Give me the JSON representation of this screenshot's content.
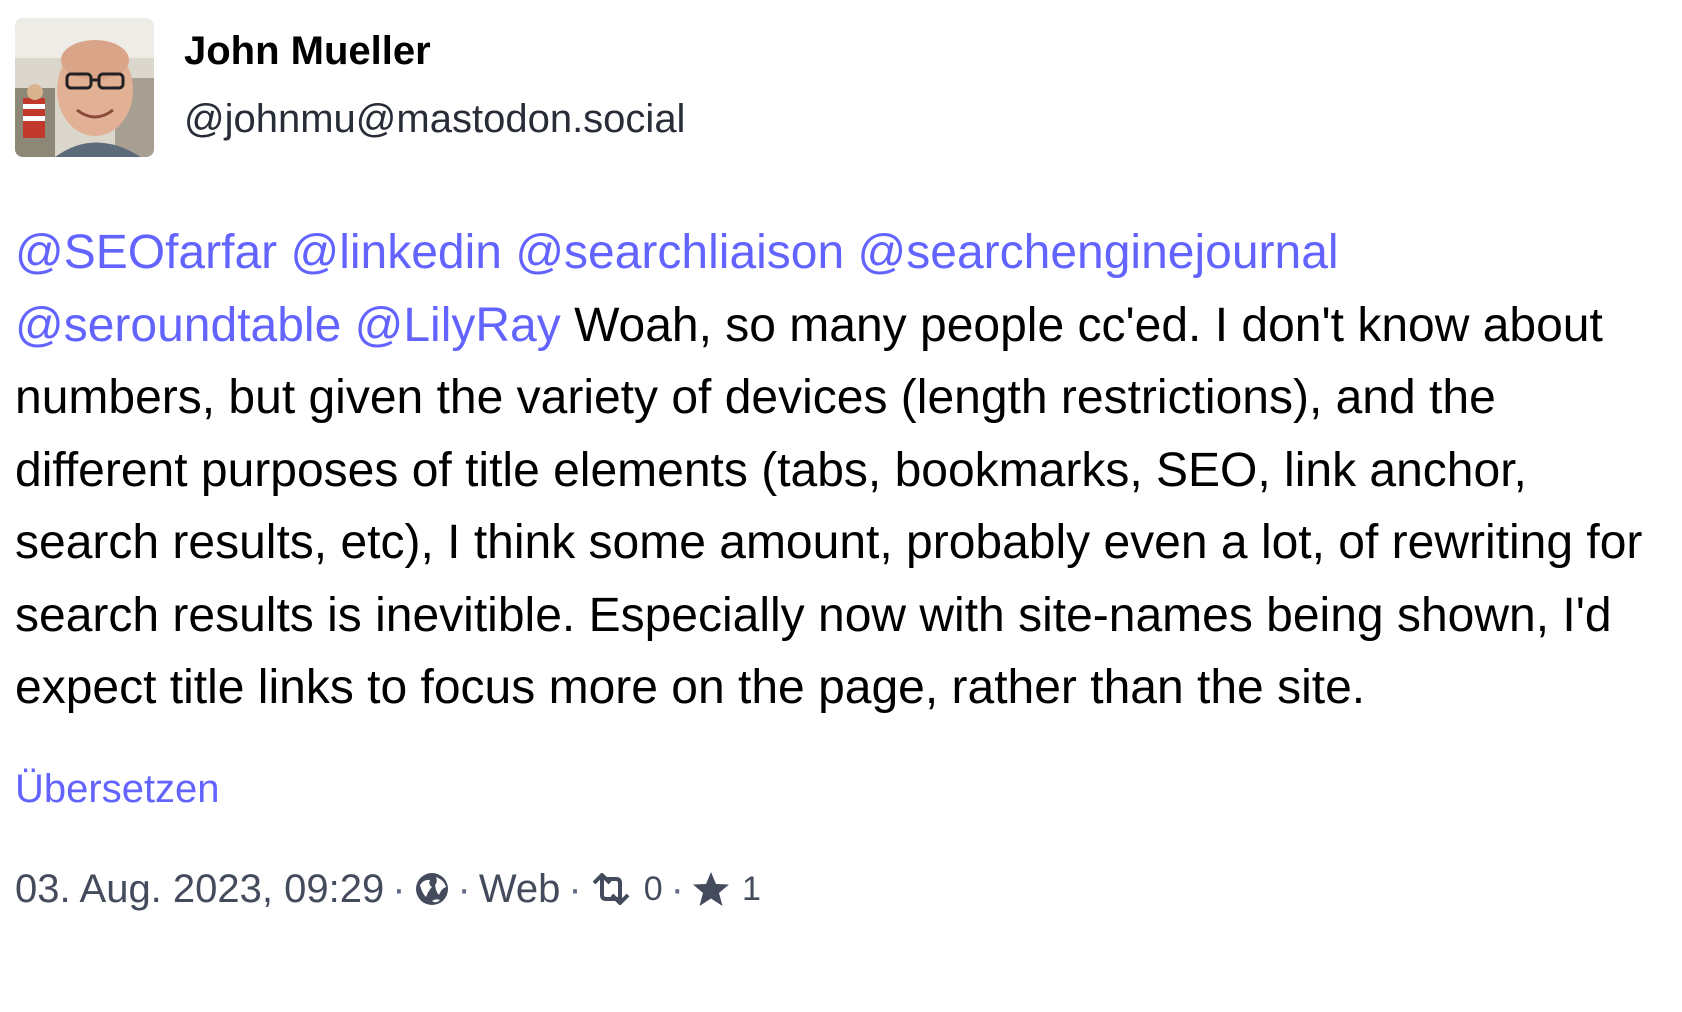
{
  "author": {
    "display_name": "John Mueller",
    "handle": "@johnmu@mastodon.social",
    "avatar_icon": "avatar-photo"
  },
  "post": {
    "mentions": [
      "@SEOfarfar",
      "@linkedin",
      "@searchliaison",
      "@searchenginejournal",
      "@seroundtable",
      "@LilyRay"
    ],
    "text": "Woah, so many people cc'ed. I don't know about numbers, but given the variety of devices (length restrictions), and the different purposes of title elements (tabs, bookmarks, SEO, link anchor, search results, etc), I think some amount, probably even a lot, of rewriting for search results is inevitible. Especially now with site-names being shown, I'd expect title links to focus more on the page, rather than the site."
  },
  "translate_label": "Übersetzen",
  "meta": {
    "timestamp": "03. Aug. 2023, 09:29",
    "separator": "·",
    "visibility_icon": "globe-icon",
    "client": "Web",
    "boost_icon": "boost-icon",
    "boost_count": "0",
    "favourite_icon": "star-icon",
    "favourite_count": "1"
  },
  "colors": {
    "link": "#6364ff",
    "text": "#000000",
    "meta": "#444b5d"
  }
}
